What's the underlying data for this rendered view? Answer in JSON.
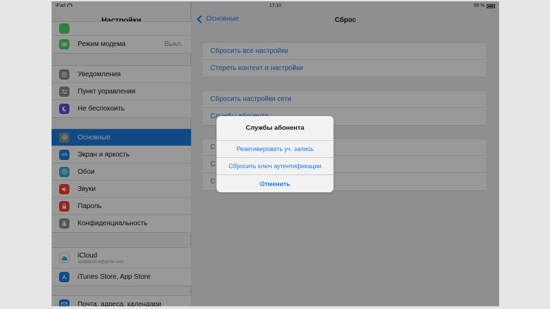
{
  "status_bar": {
    "device": "iPad",
    "time": "17:10",
    "battery": "99 %"
  },
  "sidebar": {
    "title": "Настройки",
    "items": [
      {
        "label": "",
        "icon": "green-app-icon",
        "color": "#4cd964"
      },
      {
        "label": "Режим модема",
        "value": "Выкл.",
        "icon": "chain-link-icon",
        "color": "#4cd964"
      },
      {
        "label": "Уведомления",
        "icon": "notifications-icon",
        "color": "#8e8e93"
      },
      {
        "label": "Пункт управления",
        "icon": "control-center-icon",
        "color": "#8e8e93"
      },
      {
        "label": "Не беспокоить",
        "icon": "moon-icon",
        "color": "#5856d6"
      },
      {
        "label": "Основные",
        "icon": "gear-icon",
        "color": "#8e8e93",
        "selected": true
      },
      {
        "label": "Экран и яркость",
        "icon": "brightness-icon",
        "color": "#1b7ce0"
      },
      {
        "label": "Обои",
        "icon": "wallpaper-icon",
        "color": "#34aadc"
      },
      {
        "label": "Звуки",
        "icon": "speaker-icon",
        "color": "#ff3b30"
      },
      {
        "label": "Пароль",
        "icon": "lock-icon",
        "color": "#ff3b30"
      },
      {
        "label": "Конфиденциальность",
        "icon": "hand-icon",
        "color": "#8e8e93"
      },
      {
        "label": "iCloud",
        "sublabel": "apuhbk1818@gmail.com",
        "icon": "cloud-icon",
        "color": "#ffffff"
      },
      {
        "label": "iTunes Store, App Store",
        "icon": "app-store-icon",
        "color": "#1b7ce0"
      },
      {
        "label": "Почта, адреса, календари",
        "icon": "mail-icon",
        "color": "#1b7ce0"
      }
    ]
  },
  "detail": {
    "back_label": "Основные",
    "title": "Сброс",
    "group1": [
      "Сбросить все настройки",
      "Стереть контент и настройки"
    ],
    "group2": [
      "Сбросить настройки сети",
      "Службы абонента"
    ],
    "group3": [
      "С",
      "С",
      "С"
    ]
  },
  "alert": {
    "title": "Службы абонента",
    "buttons": [
      "Реактивировать уч. запись",
      "Сбросить ключ аутентификации",
      "Отменить"
    ]
  }
}
